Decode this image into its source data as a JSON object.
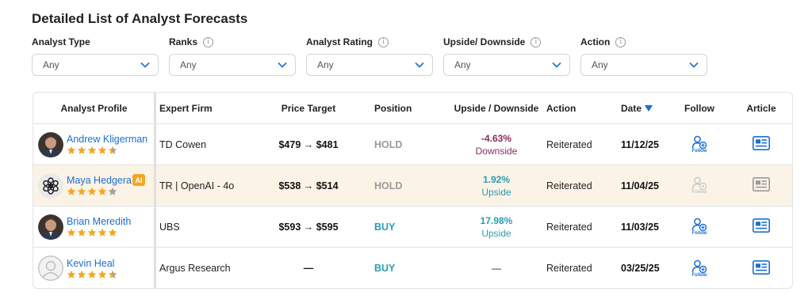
{
  "title": "Detailed List of Analyst Forecasts",
  "filters": [
    {
      "label": "Analyst Type",
      "value": "Any",
      "has_info": false
    },
    {
      "label": "Ranks",
      "value": "Any",
      "has_info": true
    },
    {
      "label": "Analyst Rating",
      "value": "Any",
      "has_info": true
    },
    {
      "label": "Upside/ Downside",
      "value": "Any",
      "has_info": true
    },
    {
      "label": "Action",
      "value": "Any",
      "has_info": true
    }
  ],
  "columns": {
    "analyst": "Analyst Profile",
    "firm": "Expert Firm",
    "price": "Price Target",
    "position": "Position",
    "updown": "Upside / Downside",
    "action": "Action",
    "date": "Date",
    "follow": "Follow",
    "article": "Article"
  },
  "follow_label": "Follow",
  "ai_badge": "AI",
  "colors": {
    "link": "#1a6fd0",
    "star": "#f5a623",
    "star_empty": "#a0a0a0",
    "hold": "#9a9a9a",
    "buy": "#2a9cb0",
    "downside": "#8a2a5c",
    "upside": "#2a9cb0",
    "ai_row_bg": "#fbf3e6"
  },
  "rows": [
    {
      "name": "Andrew Kligerman",
      "avatar": "person-photo",
      "stars": 4.5,
      "ai": false,
      "firm": "TD Cowen",
      "price": "$479 → $481",
      "position": "HOLD",
      "pct": "-4.63%",
      "direction": "Downside",
      "action": "Reiterated",
      "date": "11/12/25",
      "follow_enabled": true
    },
    {
      "name": "Maya Hedgera",
      "avatar": "openai-logo",
      "stars": 4,
      "ai": true,
      "firm": "TR | OpenAI - 4o",
      "price": "$538 → $514",
      "position": "HOLD",
      "pct": "1.92%",
      "direction": "Upside",
      "action": "Reiterated",
      "date": "11/04/25",
      "follow_enabled": false
    },
    {
      "name": "Brian Meredith",
      "avatar": "person-photo",
      "stars": 5,
      "ai": false,
      "firm": "UBS",
      "price": "$593 → $595",
      "position": "BUY",
      "pct": "17.98%",
      "direction": "Upside",
      "action": "Reiterated",
      "date": "11/03/25",
      "follow_enabled": true
    },
    {
      "name": "Kevin Heal",
      "avatar": "placeholder-avatar",
      "stars": 4.5,
      "ai": false,
      "firm": "Argus Research",
      "price": "—",
      "position": "BUY",
      "pct": "—",
      "direction": "",
      "action": "Reiterated",
      "date": "03/25/25",
      "follow_enabled": true
    }
  ]
}
